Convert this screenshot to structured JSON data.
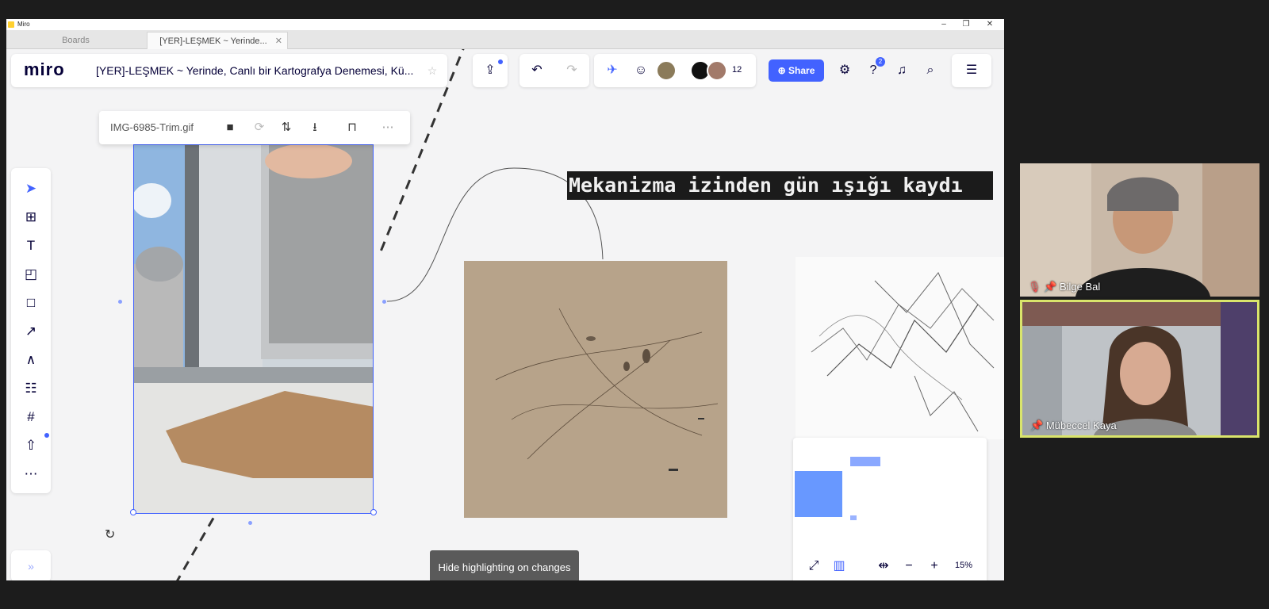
{
  "window": {
    "title": "Miro",
    "controls": {
      "minimize": "–",
      "restore": "❐",
      "close": "✕"
    }
  },
  "tabs": [
    {
      "label": "Boards"
    },
    {
      "label": "[YER]-LEŞMEK ~ Yerinde...",
      "close": "✕"
    }
  ],
  "header": {
    "logo": "miro",
    "board_name": "[YER]-LEŞMEK ~ Yerinde, Canlı bir Kartografya Denemesi, Kü...",
    "collaborator_count": "12",
    "share_label": "Share",
    "help_badge": "2"
  },
  "gif_toolbar": {
    "filename": "IMG-6985-Trim.gif"
  },
  "canvas": {
    "heading": "Mekanizma izinden gün ışığı kaydı",
    "hide_highlighting_label": "Hide highlighting on changes"
  },
  "minimap": {
    "zoom_level": "15%"
  },
  "video": {
    "participants": [
      {
        "name": "Bilge Bal"
      },
      {
        "name": "Mübeccel Kaya"
      }
    ]
  },
  "colors": {
    "accent": "#4262ff",
    "speaker_border": "#d9e46b"
  }
}
